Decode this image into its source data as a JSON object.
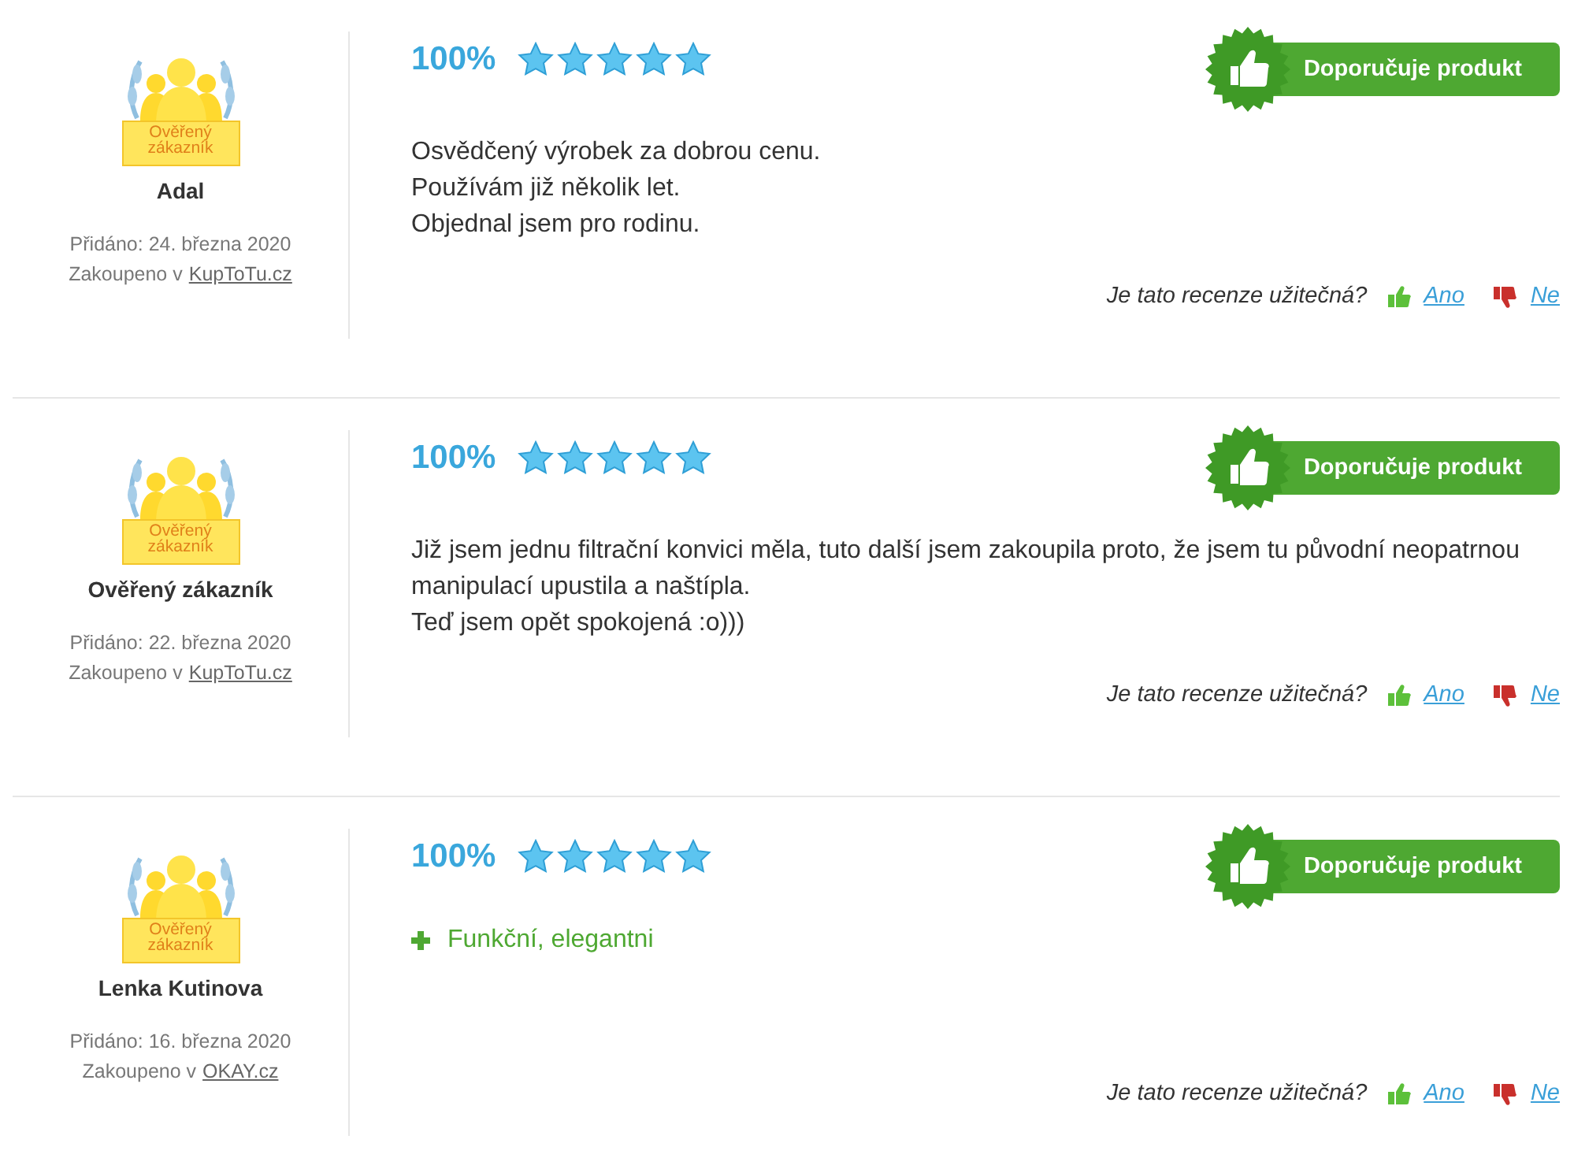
{
  "reviews": [
    {
      "badge": "Ověřený zákazník",
      "author": "Adal",
      "added": "Přidáno: 24. března 2020",
      "bought_prefix": "Zakoupeno v",
      "shop": "KupToTu.cz",
      "percent": "100%",
      "stars": 5,
      "recommends": true,
      "recommend_label": "Doporučuje produkt",
      "lines": [
        {
          "kind": "text",
          "text": "Osvědčený výrobek za dobrou cenu."
        },
        {
          "kind": "text",
          "text": "Používám již několik let."
        },
        {
          "kind": "text",
          "text": "Objednal jsem pro rodinu."
        }
      ],
      "helpful_question": "Je tato recenze užitečná?",
      "yes": "Ano",
      "no": "Ne"
    },
    {
      "badge": "Ověřený zákazník",
      "author": "Ověřený zákazník",
      "added": "Přidáno: 22. března 2020",
      "bought_prefix": "Zakoupeno v",
      "shop": "KupToTu.cz",
      "percent": "100%",
      "stars": 5,
      "recommends": true,
      "recommend_label": "Doporučuje produkt",
      "lines": [
        {
          "kind": "text",
          "text": "Již jsem jednu filtrační konvici měla, tuto další jsem zakoupila proto, že jsem tu původní neopatrnou manipulací upustila a naštípla."
        },
        {
          "kind": "text",
          "text": "Teď jsem opět spokojená :o)))"
        }
      ],
      "helpful_question": "Je tato recenze užitečná?",
      "yes": "Ano",
      "no": "Ne"
    },
    {
      "badge": "Ověřený zákazník",
      "author": "Lenka Kutinova",
      "added": "Přidáno: 16. března 2020",
      "bought_prefix": "Zakoupeno v",
      "shop": "OKAY.cz",
      "percent": "100%",
      "stars": 5,
      "recommends": true,
      "recommend_label": "Doporučuje produkt",
      "lines": [
        {
          "kind": "pro",
          "text": "Funkční, elegantni"
        }
      ],
      "helpful_question": "Je tato recenze užitečná?",
      "yes": "Ano",
      "no": "Ne"
    }
  ]
}
